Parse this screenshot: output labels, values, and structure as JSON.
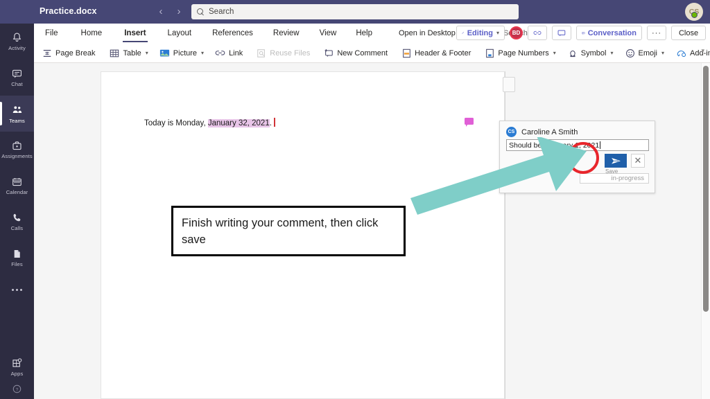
{
  "titlebar": {
    "doc_title": "Practice.docx",
    "back_icon": "chevron-left-icon",
    "forward_icon": "chevron-right-icon",
    "search_placeholder": "Search",
    "avatar_initials": "CS",
    "presence": "available"
  },
  "rail": {
    "items": [
      {
        "label": "Activity",
        "icon": "bell-icon",
        "active": false
      },
      {
        "label": "Chat",
        "icon": "chat-icon",
        "active": false
      },
      {
        "label": "Teams",
        "icon": "teams-icon",
        "active": true
      },
      {
        "label": "Assignments",
        "icon": "assignments-icon",
        "active": false
      },
      {
        "label": "Calendar",
        "icon": "calendar-icon",
        "active": false
      },
      {
        "label": "Calls",
        "icon": "phone-icon",
        "active": false
      },
      {
        "label": "Files",
        "icon": "files-icon",
        "active": false
      }
    ],
    "more_label": "more-options",
    "apps_label": "Apps",
    "apps_icon": "apps-icon",
    "help_icon": "help-icon"
  },
  "ribbon": {
    "tabs": [
      {
        "label": "File",
        "selected": false
      },
      {
        "label": "Home",
        "selected": false
      },
      {
        "label": "Insert",
        "selected": true
      },
      {
        "label": "Layout",
        "selected": false
      },
      {
        "label": "References",
        "selected": false
      },
      {
        "label": "Review",
        "selected": false
      },
      {
        "label": "View",
        "selected": false
      },
      {
        "label": "Help",
        "selected": false
      }
    ],
    "open_desktop": "Open in Desktop App",
    "search_label": "Search",
    "search_icon": "search-bulb-icon",
    "editing_label": "Editing",
    "editing_icon": "pencil-icon",
    "coauthor_initials": "BD",
    "link_icon": "link-icon",
    "comment_icon": "comment-icon",
    "conversation_label": "Conversation",
    "conversation_icon": "conversation-icon",
    "more_label": "···",
    "close_label": "Close",
    "collapse_icon": "chevron-down-icon",
    "commands": [
      {
        "label": "Page Break",
        "icon": "page-break-icon",
        "dropdown": false,
        "disabled": false
      },
      {
        "label": "Table",
        "icon": "table-icon",
        "dropdown": true,
        "disabled": false
      },
      {
        "label": "Picture",
        "icon": "picture-icon",
        "dropdown": true,
        "disabled": false
      },
      {
        "label": "Link",
        "icon": "link-icon",
        "dropdown": false,
        "disabled": false
      },
      {
        "label": "Reuse Files",
        "icon": "reuse-files-icon",
        "dropdown": false,
        "disabled": true
      },
      {
        "label": "New Comment",
        "icon": "new-comment-icon",
        "dropdown": false,
        "disabled": false
      },
      {
        "label": "Header & Footer",
        "icon": "header-footer-icon",
        "dropdown": false,
        "disabled": false
      },
      {
        "label": "Page Numbers",
        "icon": "page-numbers-icon",
        "dropdown": true,
        "disabled": false
      },
      {
        "label": "Symbol",
        "icon": "symbol-icon",
        "dropdown": true,
        "disabled": false
      },
      {
        "label": "Emoji",
        "icon": "emoji-icon",
        "dropdown": true,
        "disabled": false
      },
      {
        "label": "Add-ins",
        "icon": "add-ins-icon",
        "dropdown": false,
        "disabled": false
      }
    ]
  },
  "document": {
    "text_before": "Today is Monday, ",
    "text_highlighted": "January 32, 2021",
    "text_after": ".",
    "margin_comment_icon": "comment-balloon-icon"
  },
  "comment": {
    "author": "Caroline A Smith",
    "author_initials": "CS",
    "input_value": "Should be February 1, 2021",
    "save_icon": "send-icon",
    "save_label": "Save",
    "cancel_icon": "close-icon",
    "status_text": "in-progress"
  },
  "callout": {
    "text": "Finish writing your comment, then click save",
    "arrow_color": "#7fcec8",
    "highlight_circle_color": "#e8262c"
  },
  "colors": {
    "teams_purple": "#464775",
    "rail_dark": "#2d2c41",
    "accent_blue": "#5b5fc7",
    "save_blue": "#1f5fa9",
    "highlight_pink": "#e8c5e8",
    "coauthor_red": "#c4314b"
  }
}
